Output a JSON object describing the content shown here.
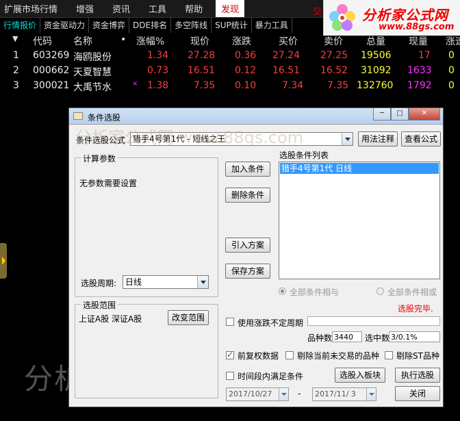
{
  "menu": {
    "items": [
      "扩展市场行情",
      "增强",
      "资讯",
      "工具",
      "帮助",
      "发现"
    ],
    "active": "发现",
    "trail": "交"
  },
  "logo": {
    "brand": "分析家公式网",
    "url": "www.88gs.com"
  },
  "tabs": [
    "行情报价",
    "资金驱动力",
    "资金博弈",
    "DDE排名",
    "多空阵线",
    "SUP统计",
    "暴力工具"
  ],
  "table": {
    "headers": [
      "代码",
      "名称",
      "•",
      "涨幅%",
      "现价",
      "涨跌",
      "买价",
      "卖价",
      "总量",
      "现量",
      "涨速"
    ],
    "rows": [
      {
        "idx": "1",
        "code": "603269",
        "name": "海鸥股份",
        "flag": "",
        "pct": "1.34",
        "price": "27.28",
        "chg": "0.36",
        "bid": "27.24",
        "ask": "27.25",
        "vol": "19506",
        "cur": "17",
        "spd": "0"
      },
      {
        "idx": "2",
        "code": "000662",
        "name": "天夏智慧",
        "flag": "",
        "pct": "0.73",
        "price": "16.51",
        "chg": "0.12",
        "bid": "16.51",
        "ask": "16.52",
        "vol": "31092",
        "cur": "1633",
        "spd": "0"
      },
      {
        "idx": "3",
        "code": "300021",
        "name": "大禹节水",
        "flag": "×",
        "pct": "1.38",
        "price": "7.35",
        "chg": "0.10",
        "bid": "7.34",
        "ask": "7.35",
        "vol": "132760",
        "cur": "1792",
        "spd": "0"
      }
    ]
  },
  "watermark": {
    "bottom": "分析家公式网  88gs",
    "dialog": "分析家公式网 www.88gs.com"
  },
  "dialog": {
    "title": "条件选股",
    "formula_label": "条件选股公式",
    "formula_value": "猎手4号第1代 - 短线之王",
    "usage_button": "用法注释",
    "view_formula_button": "查看公式",
    "params_group": "计算参数",
    "params_text": "无参数需要设置",
    "period_label": "选股周期:",
    "period_value": "日线",
    "add_condition": "加入条件",
    "delete_condition": "删除条件",
    "import_plan": "引入方案",
    "save_plan": "保存方案",
    "list_title": "选股条件列表",
    "list_items": [
      "猎手4号第1代  日线"
    ],
    "radio_and": "全部条件相与",
    "radio_or": "全部条件相或",
    "status": "选股完毕.",
    "range_group": "选股范围",
    "range_text": "上证A股 深证A股",
    "change_range": "改变范围",
    "use_uncertain_period": "使用涨跌不定周期",
    "count_label": "品种数",
    "count_value": "3440",
    "selected_label": "选中数",
    "selected_value": "3/0.1%",
    "pre_adjust": "前复权数据",
    "exclude_untraded": "剔除当前未交易的品种",
    "exclude_st": "剔除ST品种",
    "time_window": "时间段内满足条件",
    "select_to_block": "选股入板块",
    "execute": "执行选股",
    "date_start": "2017/10/27",
    "date_sep": "-",
    "date_end": "2017/11/ 3",
    "close": "关闭"
  }
}
